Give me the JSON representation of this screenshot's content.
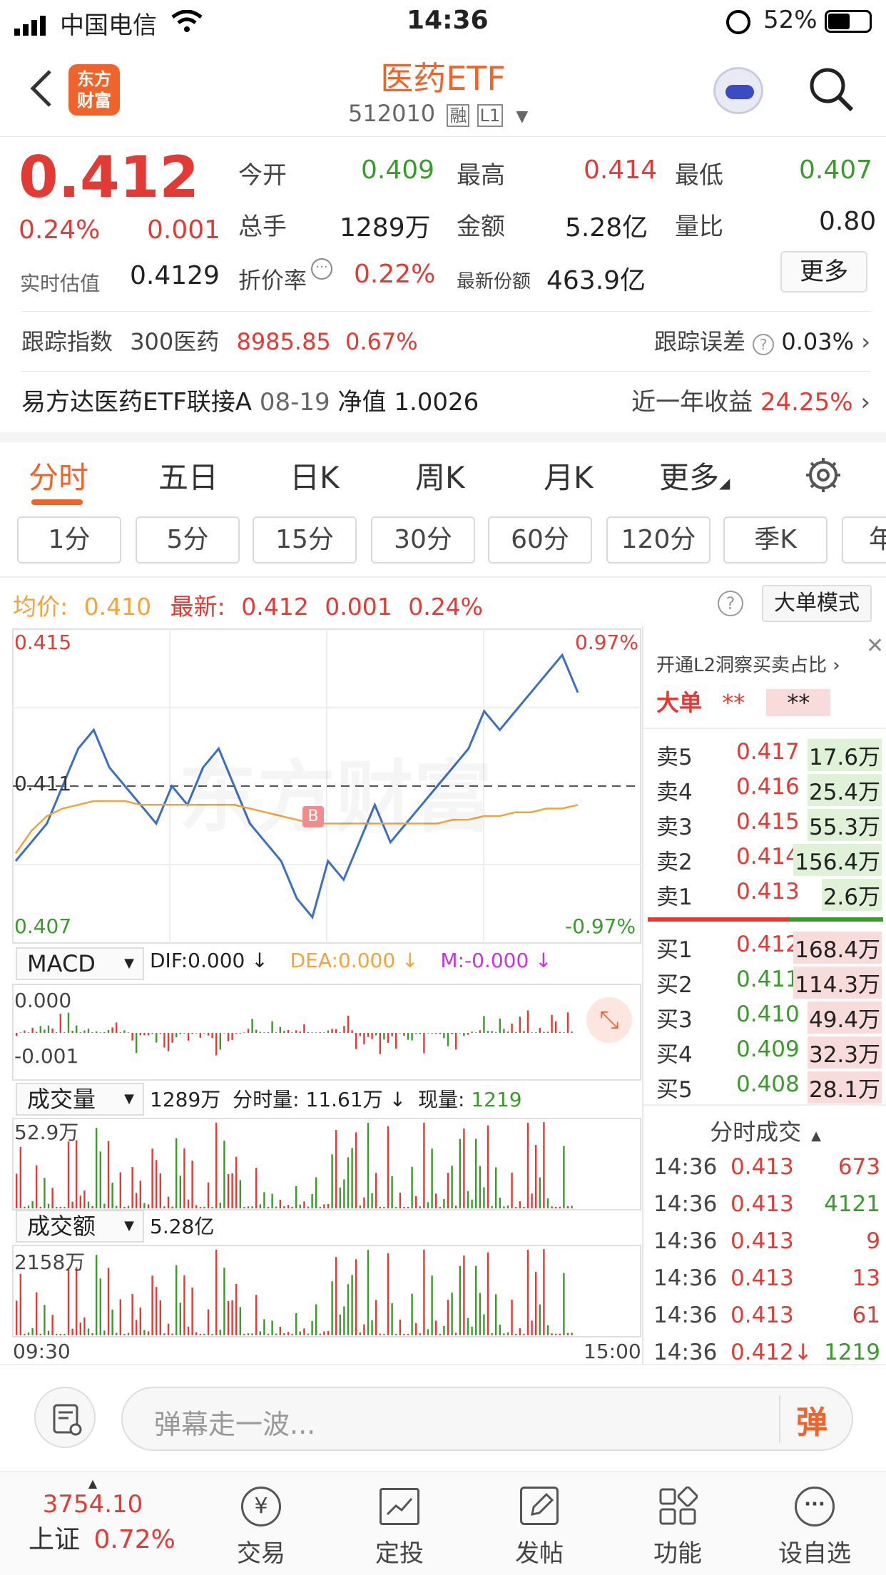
{
  "status": {
    "carrier": "中国电信",
    "time": "14:36",
    "battery": "52%"
  },
  "header": {
    "logo_line1": "东方",
    "logo_line2": "财富",
    "title": "医药ETF",
    "code": "512010",
    "tag_margin": "融",
    "tag_level": "L1"
  },
  "quote": {
    "price": "0.412",
    "change_pct": "0.24%",
    "change": "0.001",
    "open_label": "今开",
    "open": "0.409",
    "high_label": "最高",
    "high": "0.414",
    "low_label": "最低",
    "low": "0.407",
    "volume_label": "总手",
    "volume": "1289万",
    "amount_label": "金额",
    "amount": "5.28亿",
    "ratio_label": "量比",
    "ratio": "0.80",
    "iopv_label": "实时估值",
    "iopv": "0.4129",
    "discount_label": "折价率",
    "discount": "0.22%",
    "shares_label": "最新份额",
    "shares": "463.9亿",
    "more_label": "更多"
  },
  "tracking": {
    "label": "跟踪指数",
    "index": "300医药",
    "value": "8985.85",
    "pct": "0.67%",
    "err_label": "跟踪误差",
    "err": "0.03%"
  },
  "fund": {
    "text": "易方达医药ETF联接A",
    "date": "08-19",
    "nav_label": "净值",
    "nav": "1.0026",
    "ret_label": "近一年收益",
    "ret": "24.25%"
  },
  "tabs": [
    "分时",
    "五日",
    "日K",
    "周K",
    "月K",
    "更多"
  ],
  "periods": [
    "1分",
    "5分",
    "15分",
    "30分",
    "60分",
    "120分",
    "季K",
    "年"
  ],
  "avg": {
    "avg_label": "均价:",
    "avg": "0.410",
    "latest_label": "最新:",
    "latest": "0.412",
    "chg": "0.001",
    "pct": "0.24%",
    "bigorder_label": "大单模式"
  },
  "chart_data": {
    "type": "line",
    "title": "",
    "x_start": "09:30",
    "x_end": "15:00",
    "y_top": "0.415",
    "y_bottom": "0.407",
    "pct_top": "0.97%",
    "pct_bottom": "-0.97%",
    "prev_close_label": "0.411",
    "ylim": [
      0.407,
      0.415
    ],
    "series": [
      {
        "name": "最新",
        "color": "#3b6fc4",
        "values": [
          0.409,
          0.4095,
          0.41,
          0.411,
          0.412,
          0.4125,
          0.4115,
          0.411,
          0.4105,
          0.41,
          0.411,
          0.4105,
          0.4115,
          0.412,
          0.411,
          0.41,
          0.4095,
          0.409,
          0.408,
          0.4075,
          0.409,
          0.4085,
          0.4095,
          0.4105,
          0.4095,
          0.41,
          0.4105,
          0.411,
          0.4115,
          0.412,
          0.413,
          0.4125,
          0.413,
          0.4135,
          0.414,
          0.4145,
          0.4135
        ]
      },
      {
        "name": "均价",
        "color": "#f2a33a",
        "values": [
          0.4092,
          0.4098,
          0.4102,
          0.4104,
          0.4105,
          0.4106,
          0.4106,
          0.4106,
          0.4105,
          0.4105,
          0.4105,
          0.4105,
          0.4105,
          0.4105,
          0.4105,
          0.4104,
          0.4103,
          0.4102,
          0.4101,
          0.41,
          0.41,
          0.41,
          0.41,
          0.41,
          0.41,
          0.41,
          0.41,
          0.41,
          0.4101,
          0.4101,
          0.4102,
          0.4102,
          0.4103,
          0.4103,
          0.4104,
          0.4104,
          0.4105
        ]
      }
    ]
  },
  "macd": {
    "label": "MACD",
    "dif": "DIF:0.000",
    "dea": "DEA:0.000",
    "m": "M:-0.000",
    "top": "0.000",
    "bottom": "-0.001"
  },
  "vol": {
    "label": "成交量",
    "total": "1289万",
    "seg_label": "分时量:",
    "seg": "11.61万",
    "cur_label": "现量:",
    "cur": "1219",
    "max": "52.9万"
  },
  "amt": {
    "label": "成交额",
    "total": "5.28亿",
    "max": "2158万"
  },
  "axis": {
    "start": "09:30",
    "end": "15:00"
  },
  "l2": {
    "promo": "开通L2洞察买卖占比",
    "big_label": "大单",
    "big_a": "**",
    "big_b": "**"
  },
  "asks": [
    {
      "label": "卖5",
      "price": "0.417",
      "vol": "17.6万"
    },
    {
      "label": "卖4",
      "price": "0.416",
      "vol": "25.4万"
    },
    {
      "label": "卖3",
      "price": "0.415",
      "vol": "55.3万"
    },
    {
      "label": "卖2",
      "price": "0.414",
      "vol": "156.4万"
    },
    {
      "label": "卖1",
      "price": "0.413",
      "vol": "2.6万"
    }
  ],
  "bids": [
    {
      "label": "买1",
      "price": "0.412",
      "vol": "168.4万"
    },
    {
      "label": "买2",
      "price": "0.411",
      "vol": "114.3万"
    },
    {
      "label": "买3",
      "price": "0.410",
      "vol": "49.4万"
    },
    {
      "label": "买4",
      "price": "0.409",
      "vol": "32.3万"
    },
    {
      "label": "买5",
      "price": "0.408",
      "vol": "28.1万"
    }
  ],
  "trades_label": "分时成交",
  "trades": [
    {
      "t": "14:36",
      "p": "0.413",
      "v": "673"
    },
    {
      "t": "14:36",
      "p": "0.413",
      "v": "4121"
    },
    {
      "t": "14:36",
      "p": "0.413",
      "v": "9"
    },
    {
      "t": "14:36",
      "p": "0.413",
      "v": "13"
    },
    {
      "t": "14:36",
      "p": "0.413",
      "v": "61"
    },
    {
      "t": "14:36",
      "p": "0.412↓",
      "v": "1219"
    }
  ],
  "comment": {
    "placeholder": "弹幕走一波...",
    "send": "弹"
  },
  "nav": {
    "index_value": "3754.10",
    "index_name": "上证",
    "index_pct": "0.72%",
    "items": [
      "交易",
      "定投",
      "发帖",
      "功能",
      "设自选"
    ]
  }
}
